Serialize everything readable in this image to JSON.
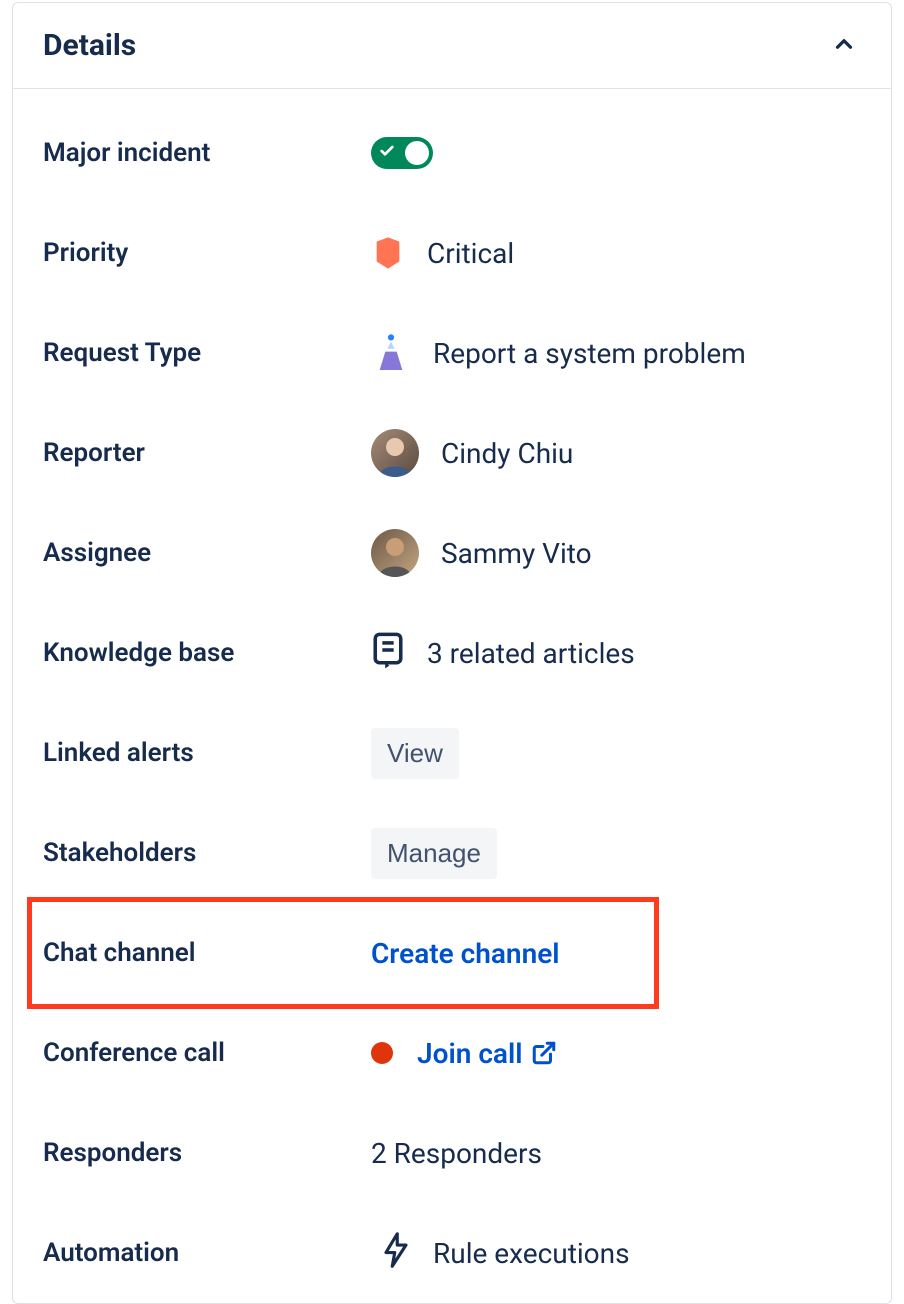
{
  "panel": {
    "title": "Details"
  },
  "fields": {
    "major_incident": {
      "label": "Major incident",
      "enabled": true
    },
    "priority": {
      "label": "Priority",
      "value": "Critical"
    },
    "request_type": {
      "label": "Request Type",
      "value": "Report a system problem"
    },
    "reporter": {
      "label": "Reporter",
      "value": "Cindy Chiu"
    },
    "assignee": {
      "label": "Assignee",
      "value": "Sammy Vito"
    },
    "knowledge_base": {
      "label": "Knowledge base",
      "value": "3 related articles"
    },
    "linked_alerts": {
      "label": "Linked alerts",
      "button": "View"
    },
    "stakeholders": {
      "label": "Stakeholders",
      "button": "Manage"
    },
    "chat_channel": {
      "label": "Chat channel",
      "link": "Create channel"
    },
    "conference_call": {
      "label": "Conference call",
      "link": "Join call"
    },
    "responders": {
      "label": "Responders",
      "value": "2 Responders"
    },
    "automation": {
      "label": "Automation",
      "value": "Rule executions"
    }
  }
}
